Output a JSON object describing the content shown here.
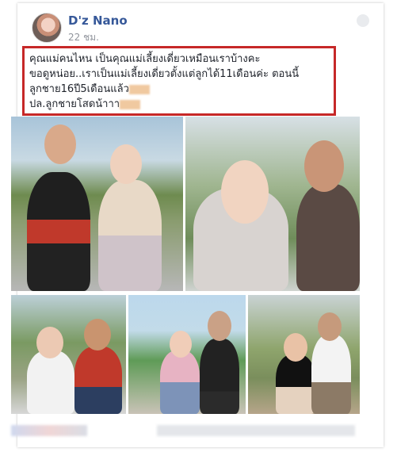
{
  "post": {
    "author": "D'z Nano",
    "time": "22 ชม.",
    "text_lines": [
      "คุณแม่คนไหน เป็นคุณแม่เลี้ยงเดี่ยวเหมือนเราบ้างคะ",
      "ขอดูหน่อย..เราเป็นแม่เลี้ยงเดี่ยวตั้งแต่ลูกได้11เดือนค่ะ ตอนนี้",
      "ลูกชาย16ปี5เดือนแล้ว",
      "ปล.ลูกชายโสดน้าาา"
    ]
  },
  "photos": [
    "photo-1",
    "photo-2",
    "photo-3",
    "photo-4",
    "photo-5"
  ],
  "icons": {
    "menu": "chevron-down-icon",
    "avatar": "avatar"
  }
}
